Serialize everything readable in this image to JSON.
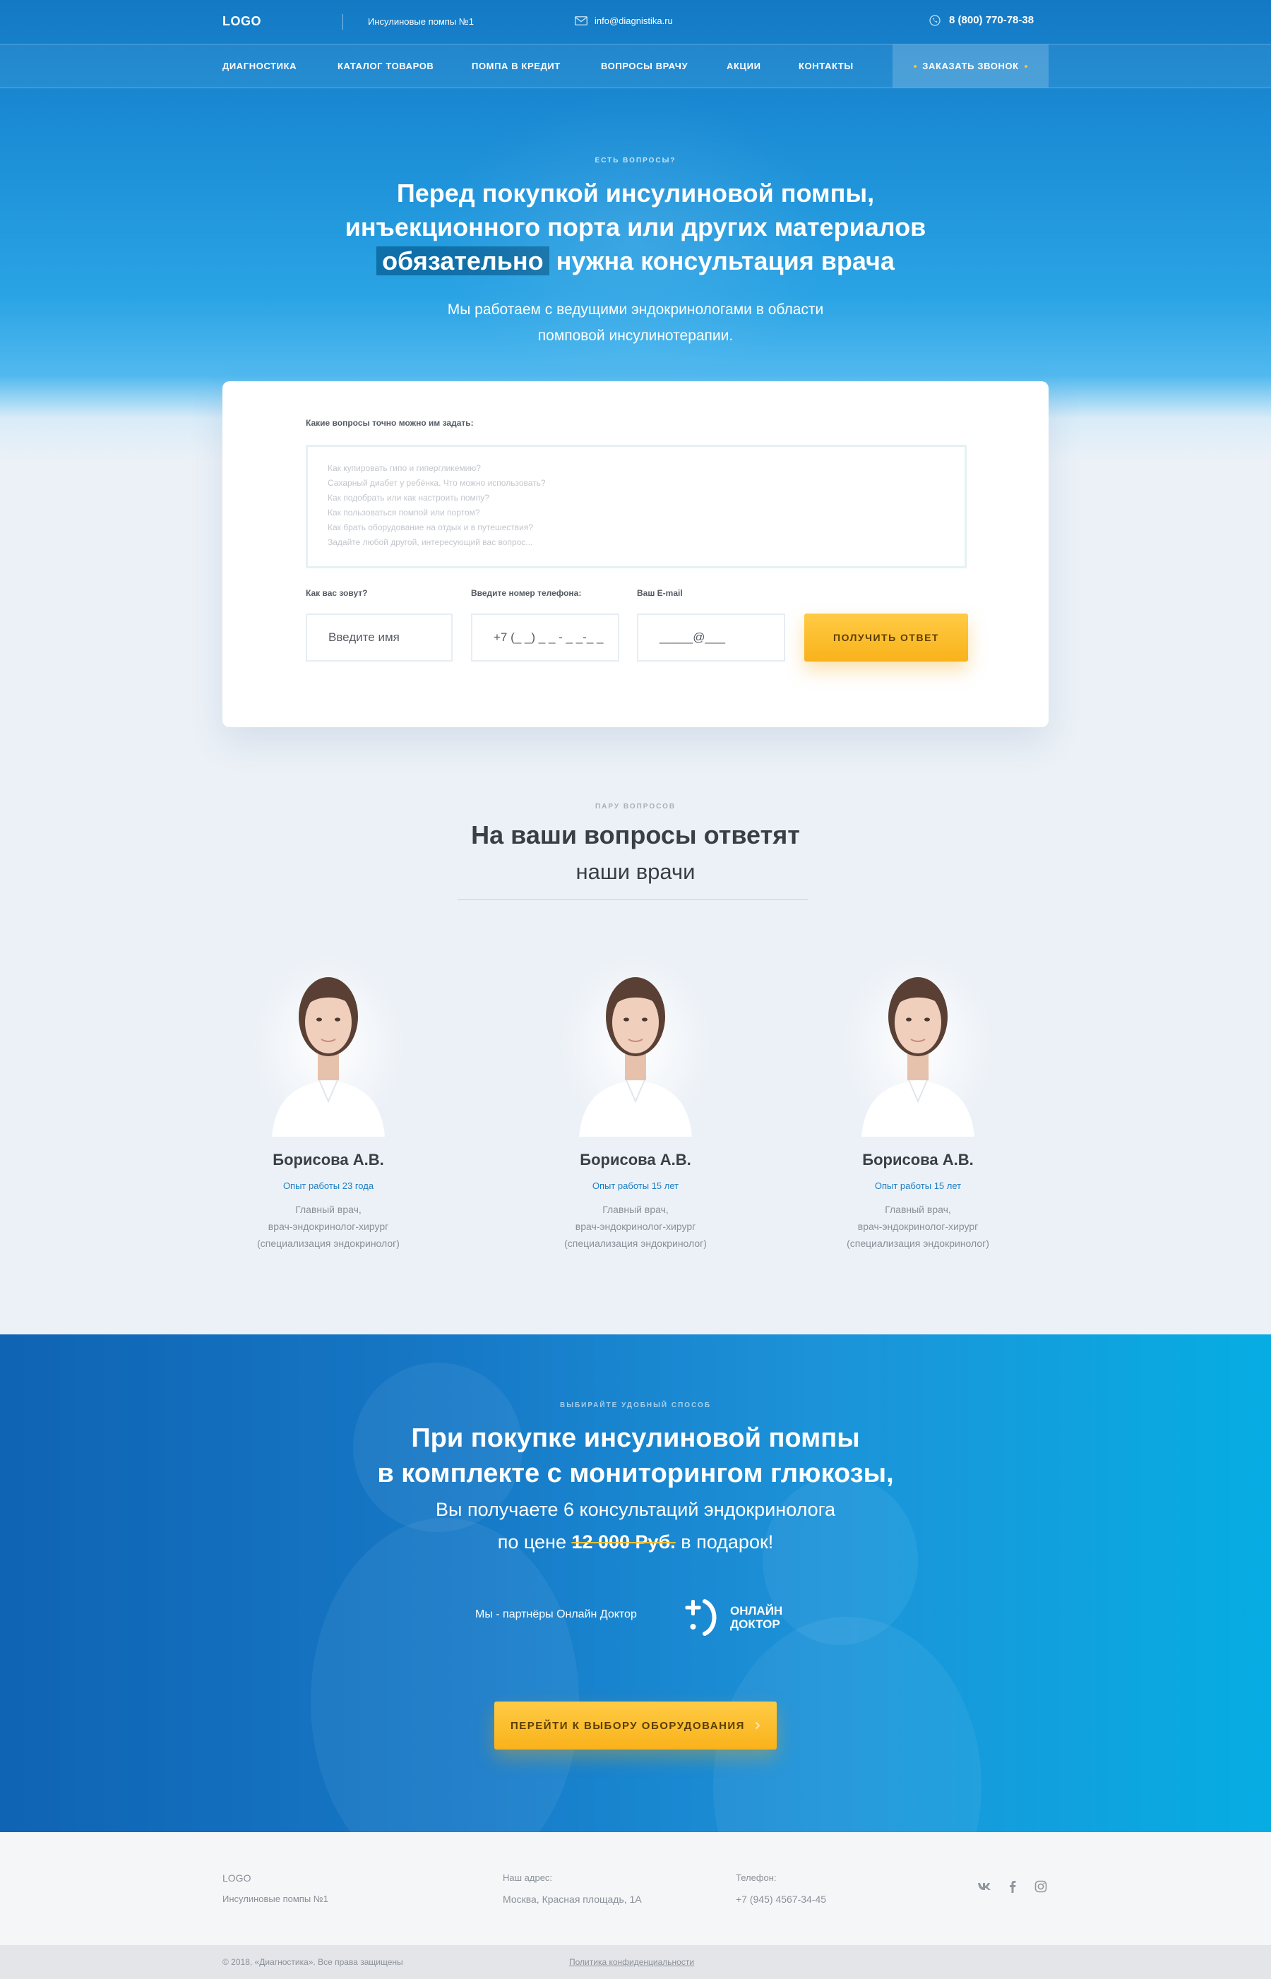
{
  "header": {
    "logo": "LOGO",
    "tagline": "Инсулиновые помпы №1",
    "email": "info@diagnistika.ru",
    "phone": "8 (800) 770-78-38"
  },
  "nav": {
    "items": [
      "Диагностика",
      "Каталог товаров",
      "Помпа в кредит",
      "Вопросы врачу",
      "Акции",
      "Контакты"
    ],
    "cta": "Заказать звонок"
  },
  "hero": {
    "eyebrow": "Есть вопросы?",
    "title_line1": "Перед покупкой  инсулиновой помпы,",
    "title_line2": "инъекционного порта или других материалов",
    "title_highlight": "обязательно",
    "title_line3_rest": " нужна консультация врача",
    "subtitle_line1": "Мы работаем с ведущими эндокринологами в области",
    "subtitle_line2": "помповой инсулинотерапии."
  },
  "form": {
    "questions_label": "Какие вопросы точно можно им задать:",
    "question_placeholders": [
      "Как купировать гипо и гипергликемию?",
      "Сахарный диабет у ребёнка. Что можно использовать?",
      "Как подобрать или как настроить помпу?",
      "Как пользоваться помпой или портом?",
      "Как брать оборудование на отдых и в путешествия?",
      "Задайте любой другой, интересующий вас вопрос..."
    ],
    "name_label": "Как вас зовут?",
    "name_placeholder": "Введите имя",
    "phone_label": "Введите номер телефона:",
    "phone_placeholder": "+7 (_ _) _ _ - _ _-_ _",
    "email_label": "Ваш E-mail",
    "email_placeholder": "_____@___",
    "submit": "Получить ответ"
  },
  "doctors_section": {
    "eyebrow": "Пару вопросов",
    "title": "На ваши вопросы ответят",
    "subtitle": "наши врачи",
    "doctors": [
      {
        "name": "Борисова А.В.",
        "experience": "Опыт работы 23 года",
        "desc1": "Главный врач,",
        "desc2": "врач-эндокринолог-хирург",
        "desc3": "(специализация эндокринолог)"
      },
      {
        "name": "Борисова А.В.",
        "experience": "Опыт работы 15 лет",
        "desc1": "Главный врач,",
        "desc2": "врач-эндокринолог-хирург",
        "desc3": "(специализация эндокринолог)"
      },
      {
        "name": "Борисова А.В.",
        "experience": "Опыт работы 15 лет",
        "desc1": "Главный врач,",
        "desc2": "врач-эндокринолог-хирург",
        "desc3": "(специализация эндокринолог)"
      }
    ]
  },
  "promo": {
    "eyebrow": "Выбирайте удобный способ",
    "title_line1": "При покупке инсулиновой помпы",
    "title_line2": "в комплекте с мониторингом глюкозы,",
    "sub_line1": "Вы получаете 6 консультаций эндокринолога",
    "sub_prefix": "по цене ",
    "old_price": "12 000 Руб.",
    "sub_suffix": "  в подарок!",
    "partners_text": "Мы - партнёры Онлайн Доктор",
    "partner_logo_line1": "Онлайн",
    "partner_logo_line2": "Доктор",
    "button": "Перейти к выбору оборудования"
  },
  "footer": {
    "logo": "LOGO",
    "tagline": "Инсулиновые помпы №1",
    "address_label": "Наш адрес:",
    "address": "Москва, Красная площадь, 1А",
    "phone_label": "Телефон:",
    "phone": "+7 (945) 4567-34-45",
    "social_icons": [
      "vk-icon",
      "facebook-icon",
      "instagram-icon"
    ],
    "copyright": "© 2018, «Диагностика». Все права защищены",
    "privacy": "Политика конфиденциальности"
  },
  "colors": {
    "primary_blue": "#1479c4",
    "accent_yellow": "#ffc233",
    "link_blue": "#1b7fc4"
  }
}
